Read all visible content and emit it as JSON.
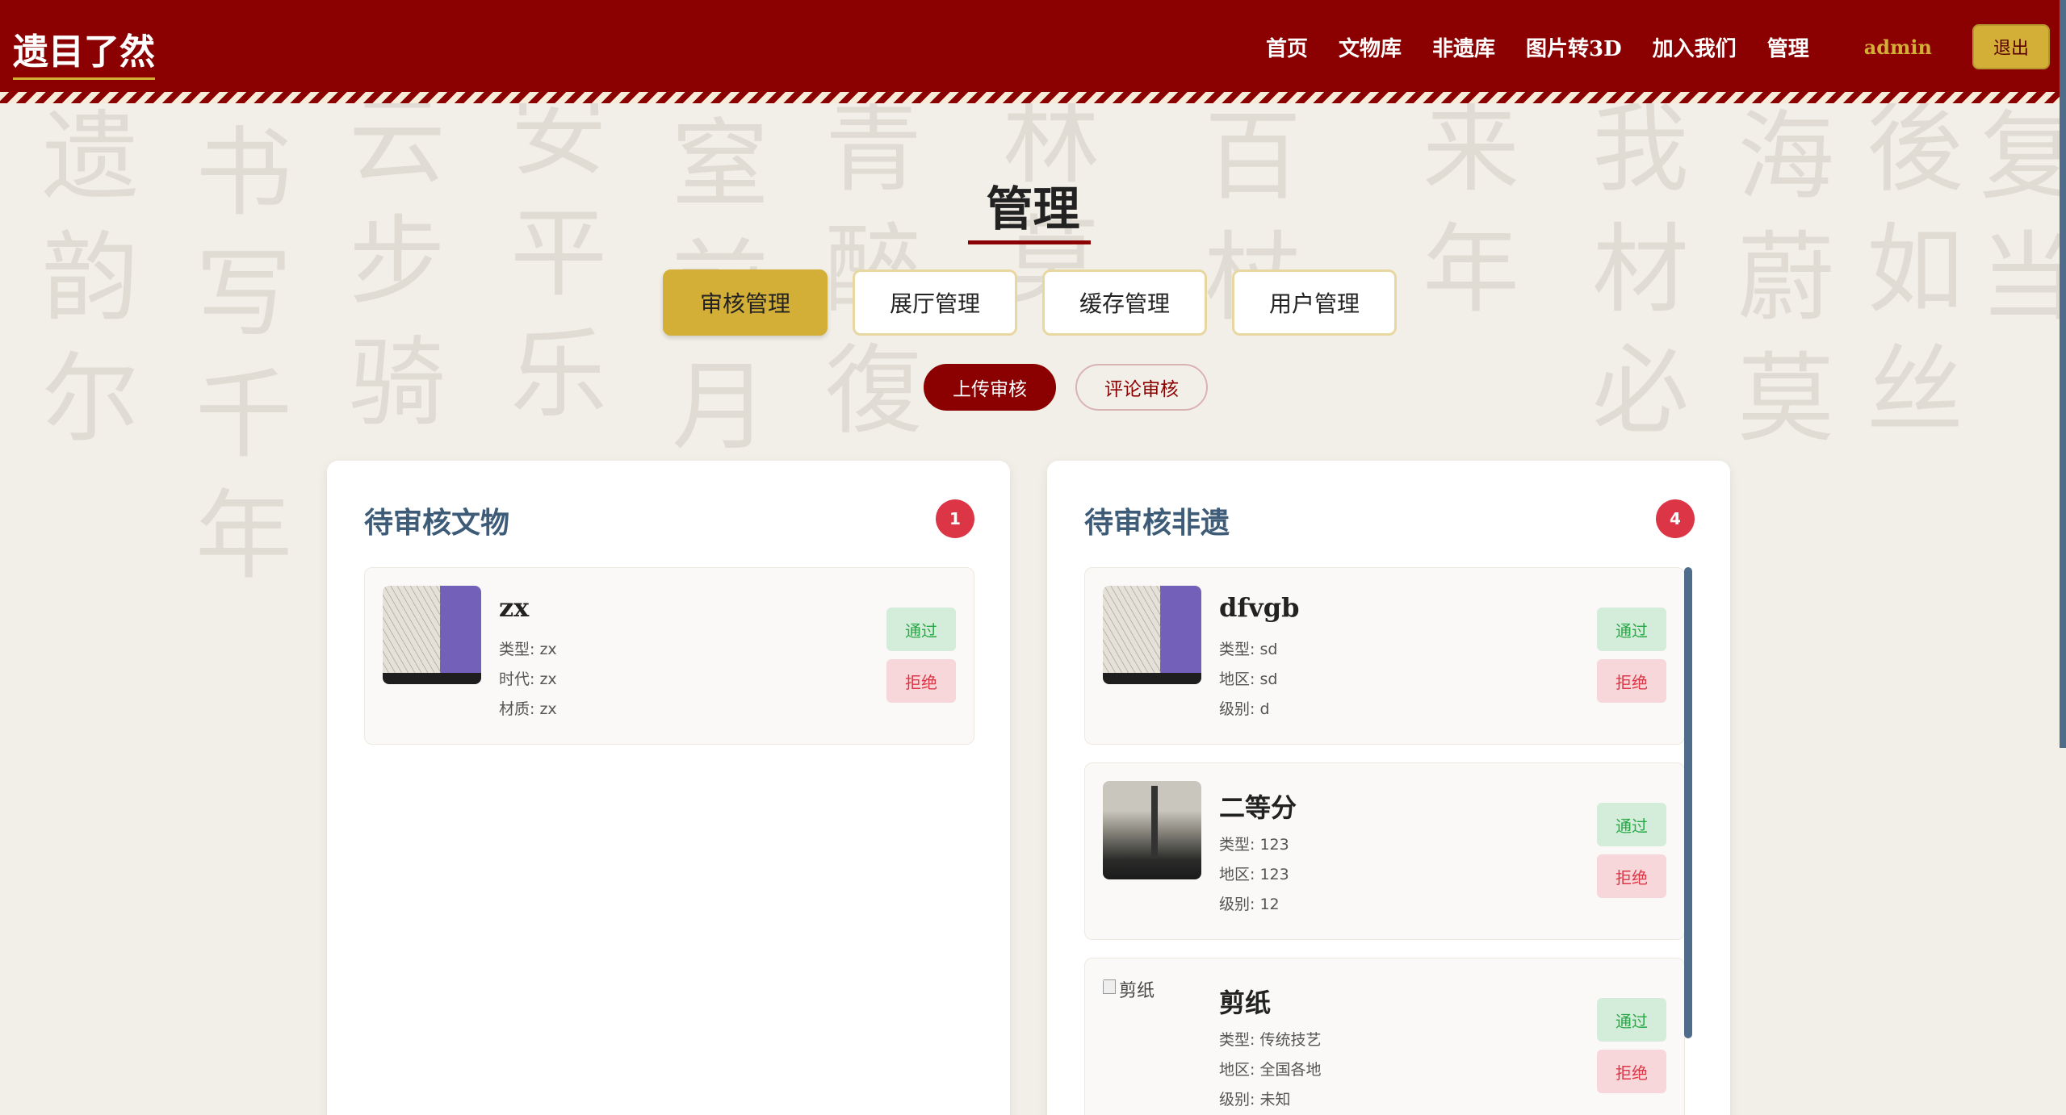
{
  "header": {
    "logo": "遗目了然",
    "nav": [
      "首页",
      "文物库",
      "非遗库",
      "图片转3D",
      "加入我们",
      "管理"
    ],
    "user": "admin",
    "logout": "退出"
  },
  "page": {
    "title": "管理",
    "main_tabs": [
      "审核管理",
      "展厅管理",
      "缓存管理",
      "用户管理"
    ],
    "sub_tabs": [
      "上传审核",
      "评论审核"
    ]
  },
  "artifacts": {
    "title": "待审核文物",
    "count": "1",
    "items": [
      {
        "name": "zx",
        "meta1": "类型: zx",
        "meta2": "时代: zx",
        "meta3": "材质: zx"
      }
    ]
  },
  "heritage": {
    "title": "待审核非遗",
    "count": "4",
    "items": [
      {
        "name": "dfvgb",
        "meta1": "类型: sd",
        "meta2": "地区: sd",
        "meta3": "级别: d"
      },
      {
        "name": "二等分",
        "meta1": "类型: 123",
        "meta2": "地区: 123",
        "meta3": "级别: 12"
      },
      {
        "name": "剪纸",
        "alt": "剪纸",
        "meta1": "类型: 传统技艺",
        "meta2": "地区: 全国各地",
        "meta3": "级别: 未知"
      }
    ]
  },
  "buttons": {
    "approve": "通过",
    "reject": "拒绝"
  }
}
